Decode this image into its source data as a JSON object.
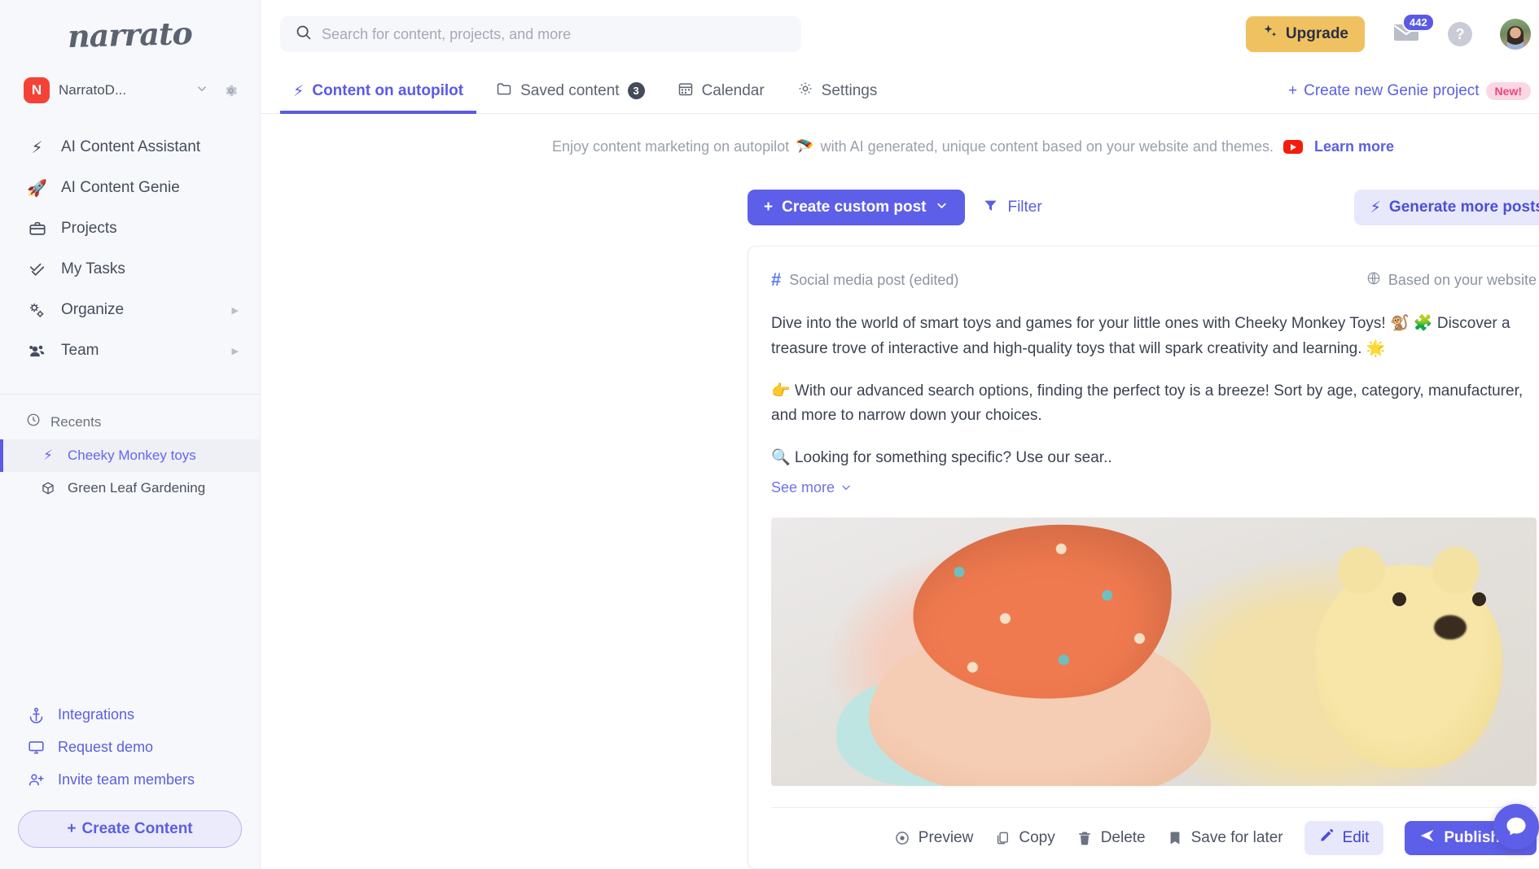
{
  "brand": {
    "logo_text": "narrato",
    "accent": "#5a5ae6",
    "upgrade_color": "#f0c160"
  },
  "sidebar": {
    "workspace": {
      "initial": "N",
      "name": "NarratoD...",
      "chevron": "chevron-down-icon",
      "gear": "gear-icon"
    },
    "nav": [
      {
        "icon": "lightning-icon",
        "glyph": "⚡",
        "label": "AI Content Assistant",
        "arrow": ""
      },
      {
        "icon": "rocket-icon",
        "glyph": "🚀",
        "label": "AI Content Genie",
        "arrow": ""
      },
      {
        "icon": "briefcase-icon",
        "glyph": "💼",
        "label": "Projects",
        "arrow": ""
      },
      {
        "icon": "check-double-icon",
        "glyph": "✓",
        "label": "My Tasks",
        "arrow": ""
      },
      {
        "icon": "gears-icon",
        "glyph": "⚙",
        "label": "Organize",
        "arrow": "▶"
      },
      {
        "icon": "team-icon",
        "glyph": "👥",
        "label": "Team",
        "arrow": "▶"
      }
    ],
    "recents": {
      "label": "Recents",
      "icon": "clock-icon",
      "items": [
        {
          "icon": "lightning-icon",
          "glyph": "⚡",
          "label": "Cheeky Monkey toys",
          "active": true
        },
        {
          "icon": "cube-icon",
          "glyph": "⬡",
          "label": "Green Leaf Gardening",
          "active": false
        }
      ]
    },
    "footer": [
      {
        "icon": "anchor-icon",
        "label": "Integrations"
      },
      {
        "icon": "monitor-icon",
        "label": "Request demo"
      },
      {
        "icon": "user-plus-icon",
        "label": "Invite team members"
      }
    ],
    "create_content_label": "Create Content",
    "create_content_plus": "+"
  },
  "topbar": {
    "search": {
      "placeholder": "Search for content, projects, and more",
      "value": "",
      "icon": "search-icon"
    },
    "upgrade_label": "Upgrade",
    "upgrade_icon": "sparkles-icon",
    "mail_icon": "mail-icon",
    "mail_badge": "442",
    "help_label": "?",
    "avatar": "user-avatar"
  },
  "tabs": [
    {
      "icon": "lightning-icon",
      "label": "Content on autopilot",
      "count": "",
      "active": true
    },
    {
      "icon": "folder-icon",
      "label": "Saved content",
      "count": "3",
      "active": false
    },
    {
      "icon": "calendar-icon",
      "label": "Calendar",
      "count": "",
      "active": false
    },
    {
      "icon": "gear-icon",
      "label": "Settings",
      "count": "",
      "active": false
    }
  ],
  "genie_project": {
    "plus": "+",
    "label": "Create new Genie project",
    "badge": "New!"
  },
  "banner": {
    "text_before": "Enjoy content marketing on autopilot",
    "emoji": "🪂",
    "text_after": "with AI generated, unique content based on your website and themes.",
    "youtube_icon": "youtube-icon",
    "learn_more": "Learn more"
  },
  "toolbar": {
    "create_custom_post": "Create custom post",
    "create_plus": "+",
    "create_chevron": "⌄",
    "filter_label": "Filter",
    "filter_icon": "funnel-icon",
    "generate_more": "Generate more posts",
    "generate_icon": "lightning-icon"
  },
  "post_card": {
    "type_icon": "hash-icon",
    "type_label": "Social media post (edited)",
    "source_icon": "globe-icon",
    "source_label": "Based on your website",
    "paragraphs": [
      "Dive into the world of smart toys and games for your little ones with Cheeky Monkey Toys! 🐒 🧩 Discover a treasure trove of interactive and high-quality toys that will spark creativity and learning. 🌟",
      "👉 With our advanced search options, finding the perfect toy is a breeze! Sort by age, category, manufacturer, and more to narrow down your choices.",
      "🔍 Looking for something specific? Use our sear.."
    ],
    "see_more": "See more",
    "see_more_chevron": "⌄",
    "image_alt": "baby-with-teddy-bear-photo",
    "actions": [
      {
        "icon": "eye-icon",
        "label": "Preview"
      },
      {
        "icon": "copy-icon",
        "label": "Copy"
      },
      {
        "icon": "trash-icon",
        "label": "Delete"
      },
      {
        "icon": "bookmark-icon",
        "label": "Save for later"
      }
    ],
    "edit_label": "Edit",
    "edit_icon": "pencil-icon",
    "publish_label": "Publish",
    "publish_icon": "send-icon",
    "publish_chevron": "⌄"
  },
  "chat_widget": {
    "icon": "chat-icon"
  }
}
